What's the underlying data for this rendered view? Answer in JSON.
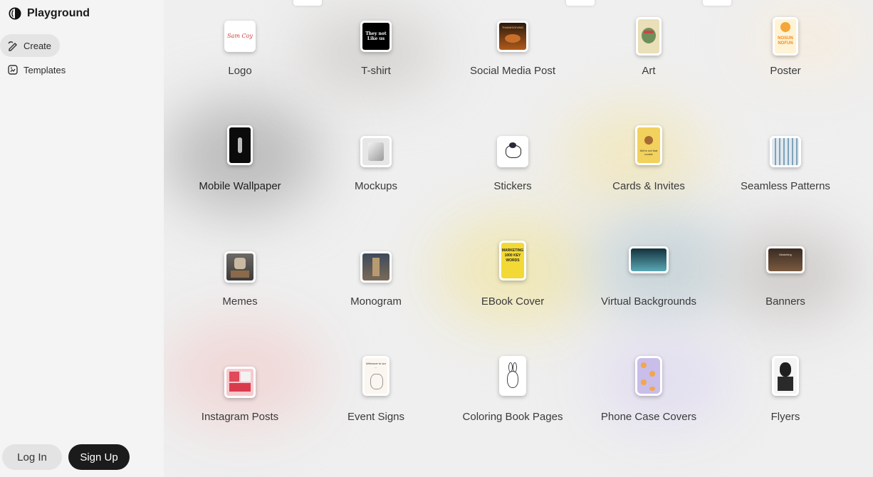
{
  "brand": {
    "name": "Playground"
  },
  "nav": [
    {
      "label": "Create",
      "icon": "pen-icon",
      "active": true
    },
    {
      "label": "Templates",
      "icon": "template-icon",
      "active": false
    }
  ],
  "auth": {
    "login_label": "Log In",
    "signup_label": "Sign Up"
  },
  "categories": [
    {
      "label": "Logo",
      "thumb": "logo-thumbnail"
    },
    {
      "label": "T-shirt",
      "thumb": "tshirt-thumbnail"
    },
    {
      "label": "Social Media Post",
      "thumb": "social-media-post-thumbnail"
    },
    {
      "label": "Art",
      "thumb": "art-thumbnail"
    },
    {
      "label": "Poster",
      "thumb": "poster-thumbnail"
    },
    {
      "label": "Mobile Wallpaper",
      "thumb": "mobile-wallpaper-thumbnail"
    },
    {
      "label": "Mockups",
      "thumb": "mockups-thumbnail"
    },
    {
      "label": "Stickers",
      "thumb": "stickers-thumbnail"
    },
    {
      "label": "Cards & Invites",
      "thumb": "cards-invites-thumbnail"
    },
    {
      "label": "Seamless Patterns",
      "thumb": "seamless-patterns-thumbnail"
    },
    {
      "label": "Memes",
      "thumb": "memes-thumbnail"
    },
    {
      "label": "Monogram",
      "thumb": "monogram-thumbnail"
    },
    {
      "label": "EBook Cover",
      "thumb": "ebook-cover-thumbnail"
    },
    {
      "label": "Virtual Backgrounds",
      "thumb": "virtual-backgrounds-thumbnail"
    },
    {
      "label": "Banners",
      "thumb": "banners-thumbnail"
    },
    {
      "label": "Instagram Posts",
      "thumb": "instagram-posts-thumbnail"
    },
    {
      "label": "Event Signs",
      "thumb": "event-signs-thumbnail"
    },
    {
      "label": "Coloring Book Pages",
      "thumb": "coloring-book-pages-thumbnail"
    },
    {
      "label": "Phone Case Covers",
      "thumb": "phone-case-covers-thumbnail"
    },
    {
      "label": "Flyers",
      "thumb": "flyers-thumbnail"
    }
  ],
  "thumb_text": {
    "logo": "Sam Coy",
    "tshirt": "They not Like us",
    "social": "THANKSGIVING",
    "poster": "NOSUN NOFUN",
    "cards": "We're not that cookie",
    "ebook": "MARKETING 1000 KEY WORDS",
    "event": "Welcome to our ...",
    "banners": "Marketing"
  }
}
